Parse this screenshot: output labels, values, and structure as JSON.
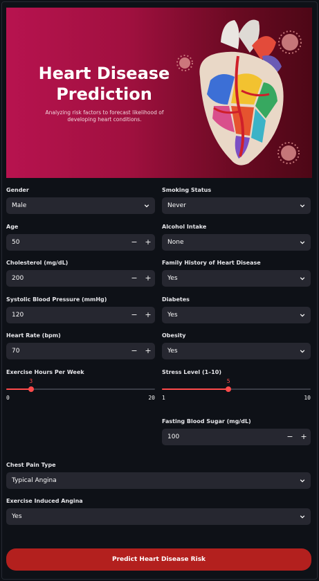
{
  "banner": {
    "title_line1": "Heart Disease",
    "title_line2": "Prediction",
    "subtitle": "Analyzing risk factors to forecast likelihood of developing heart conditions."
  },
  "fields": {
    "gender": {
      "label": "Gender",
      "value": "Male"
    },
    "smoking": {
      "label": "Smoking Status",
      "value": "Never"
    },
    "age": {
      "label": "Age",
      "value": "50"
    },
    "alcohol": {
      "label": "Alcohol Intake",
      "value": "None"
    },
    "cholesterol": {
      "label": "Cholesterol (mg/dL)",
      "value": "200"
    },
    "family_history": {
      "label": "Family History of Heart Disease",
      "value": "Yes"
    },
    "bp": {
      "label": "Systolic Blood Pressure (mmHg)",
      "value": "120"
    },
    "diabetes": {
      "label": "Diabetes",
      "value": "Yes"
    },
    "heart_rate": {
      "label": "Heart Rate (bpm)",
      "value": "70"
    },
    "obesity": {
      "label": "Obesity",
      "value": "Yes"
    },
    "exercise": {
      "label": "Exercise Hours Per Week",
      "value": 3,
      "min": 0,
      "max": 20,
      "value_text": "3",
      "min_text": "0",
      "max_text": "20"
    },
    "stress": {
      "label": "Stress Level (1–10)",
      "value": 5,
      "min": 1,
      "max": 10,
      "value_text": "5",
      "min_text": "1",
      "max_text": "10"
    },
    "fasting_sugar": {
      "label": "Fasting Blood Sugar (mg/dL)",
      "value": "100"
    },
    "chest_pain": {
      "label": "Chest Pain Type",
      "value": "Typical Angina"
    },
    "exercise_angina": {
      "label": "Exercise Induced Angina",
      "value": "Yes"
    }
  },
  "stepper": {
    "minus": "−",
    "plus": "+"
  },
  "predict_button": "Predict Heart Disease Risk",
  "colors": {
    "accent": "#ff4b4b",
    "button": "#b3201e",
    "input_bg": "#262730",
    "page_bg": "#0e1117"
  }
}
